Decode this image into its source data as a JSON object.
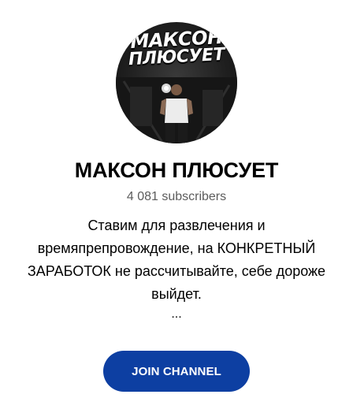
{
  "channel": {
    "avatar_text_line1": "МАКСОН",
    "avatar_text_line2": "ПЛЮСУЕТ",
    "name": "МАКСОН ПЛЮСУЕТ",
    "subscribers": "4 081 subscribers",
    "description": "Ставим для развлечения и времяпрепровождение, на КОНКРЕТНЫЙ ЗАРАБОТОК не рассчитывайте, себе дороже выйдет.",
    "more": "..."
  },
  "actions": {
    "join_label": "JOIN CHANNEL"
  },
  "colors": {
    "accent": "#0d3fa2",
    "subtitle": "#5c5c5c"
  }
}
